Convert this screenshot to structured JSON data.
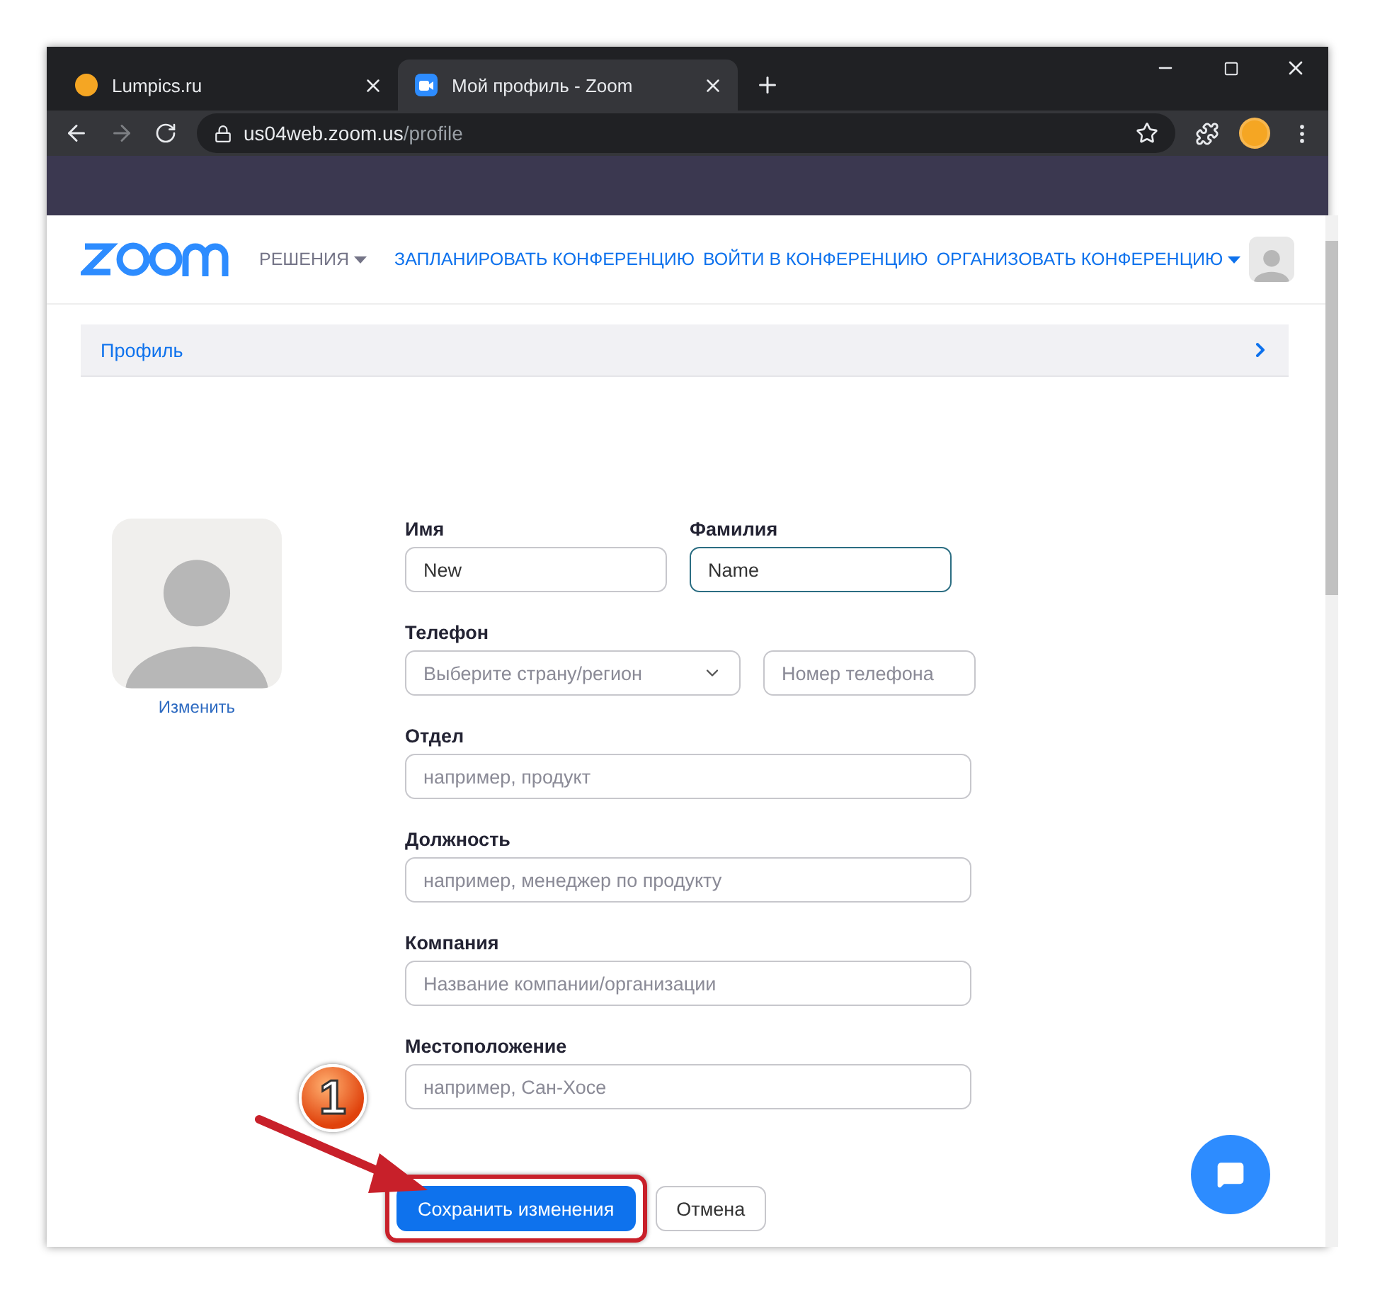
{
  "browser": {
    "tabs": [
      {
        "title": "Lumpics.ru",
        "selected": false
      },
      {
        "title": "Мой профиль - Zoom",
        "selected": true
      }
    ],
    "url": {
      "host": "us04web.zoom.us",
      "path": "/profile"
    }
  },
  "header": {
    "nav": [
      {
        "label": "РЕШЕНИЯ",
        "kind": "menu",
        "dropdown": true
      },
      {
        "label": "ЗАПЛАНИРОВАТЬ КОНФЕРЕНЦИЮ",
        "kind": "link",
        "dropdown": false
      },
      {
        "label": "ВОЙТИ В КОНФЕРЕНЦИЮ",
        "kind": "link",
        "dropdown": false
      },
      {
        "label": "ОРГАНИЗОВАТЬ КОНФЕРЕНЦИЮ",
        "kind": "link",
        "dropdown": true
      }
    ]
  },
  "breadcrumb": {
    "label": "Профиль"
  },
  "avatar": {
    "change_link": "Изменить"
  },
  "form": {
    "rows": [
      {
        "cells": [
          {
            "label": "Имя",
            "kind": "input",
            "value": "New",
            "focused": false
          },
          {
            "label": "Фамилия",
            "kind": "input",
            "value": "Name",
            "focused": true
          }
        ]
      },
      {
        "cells": [
          {
            "label": "Телефон",
            "kind": "select",
            "placeholder": "Выберите страну/регион",
            "focused": false
          },
          {
            "kind": "input",
            "placeholder": "Номер телефона",
            "focused": false
          }
        ]
      },
      {
        "cells": [
          {
            "label": "Отдел",
            "kind": "input",
            "placeholder": "например, продукт",
            "focused": false
          }
        ]
      },
      {
        "cells": [
          {
            "label": "Должность",
            "kind": "input",
            "placeholder": "например, менеджер по продукту",
            "focused": false
          }
        ]
      },
      {
        "cells": [
          {
            "label": "Компания",
            "kind": "input",
            "placeholder": "Название компании/организации",
            "focused": false
          }
        ]
      },
      {
        "cells": [
          {
            "label": "Местоположение",
            "kind": "input",
            "placeholder": "например, Сан-Хосе",
            "focused": false
          }
        ]
      }
    ],
    "buttons": [
      {
        "label": "Сохранить изменения",
        "kind": "primary",
        "highlighted": true
      },
      {
        "label": "Отмена",
        "kind": "secondary",
        "highlighted": false
      }
    ]
  },
  "annotation": {
    "step": "1"
  }
}
